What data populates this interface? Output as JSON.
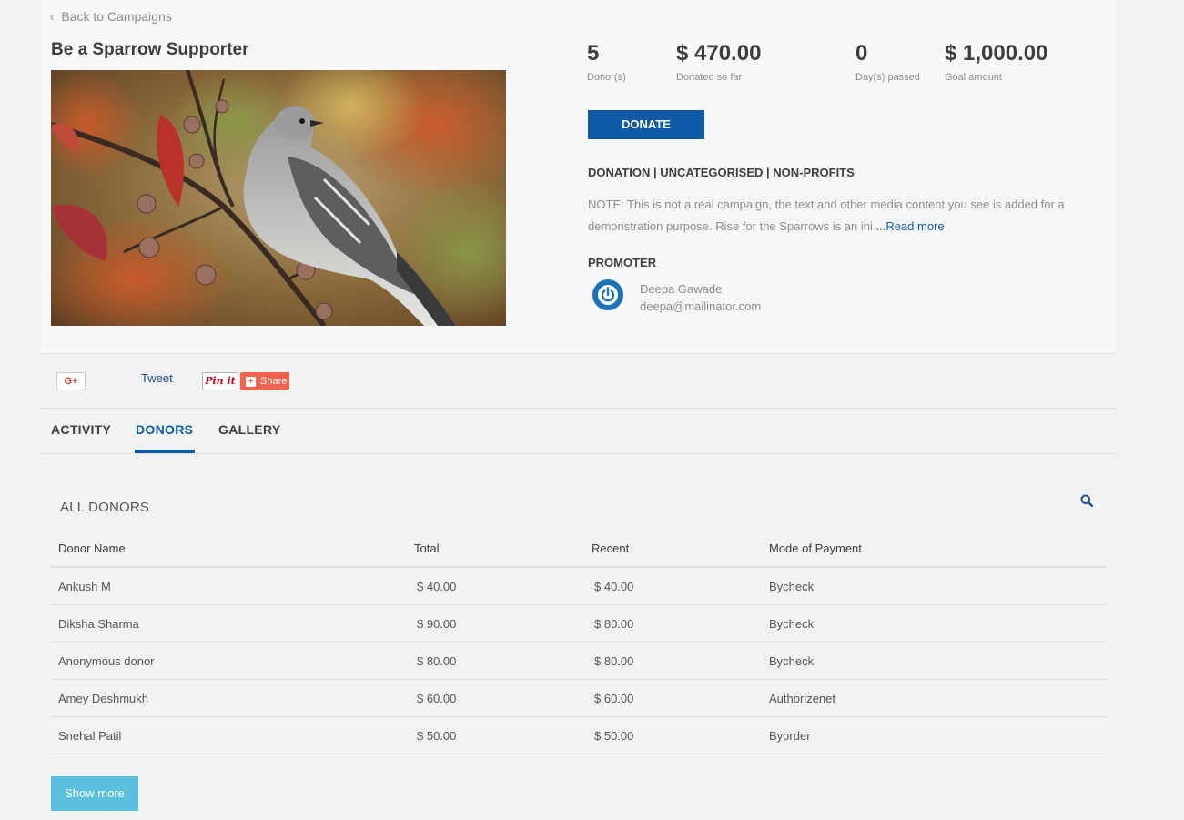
{
  "nav": {
    "back_label": "Back to Campaigns"
  },
  "campaign": {
    "title": "Be a Sparrow Supporter",
    "stats": [
      {
        "value": "5",
        "label": "Donor(s)"
      },
      {
        "value": "$ 470.00",
        "label": "Donated so far"
      },
      {
        "value": "0",
        "label": "Day(s) passed"
      },
      {
        "value": "$ 1,000.00",
        "label": "Goal amount"
      }
    ],
    "donate_label": "DONATE",
    "categories": "DONATION | UNCATEGORISED | NON-PROFITS",
    "note": "NOTE: This is not a real campaign, the text and other media content you see is added for a demonstration purpose.   Rise for the Sparrows is an ini",
    "read_more": " ...Read more"
  },
  "promoter": {
    "heading": "PROMOTER",
    "name": "Deepa Gawade",
    "email": "deepa@mailinator.com"
  },
  "share": {
    "gplus": "G+",
    "tweet": "Tweet",
    "pinit": "Pin it",
    "share": "Share"
  },
  "tabs": [
    {
      "label": "ACTIVITY"
    },
    {
      "label": "DONORS"
    },
    {
      "label": "GALLERY"
    }
  ],
  "donors": {
    "title": "ALL DONORS",
    "columns": [
      "Donor Name",
      "Total",
      "Recent",
      "Mode of Payment"
    ],
    "rows": [
      [
        "Ankush M",
        "$ 40.00",
        "$ 40.00",
        "Bycheck"
      ],
      [
        "Diksha Sharma",
        "$ 90.00",
        "$ 80.00",
        "Bycheck"
      ],
      [
        "Anonymous donor",
        "$ 80.00",
        "$ 80.00",
        "Bycheck"
      ],
      [
        "Amey Deshmukh",
        "$ 60.00",
        "$ 60.00",
        "Authorizenet"
      ],
      [
        "Snehal Patil",
        "$ 50.00",
        "$ 50.00",
        "Byorder"
      ]
    ],
    "show_more": "Show more"
  },
  "colors": {
    "brand": "#0e5aa7",
    "show_more": "#5bc0de",
    "share": "#f4644c"
  }
}
